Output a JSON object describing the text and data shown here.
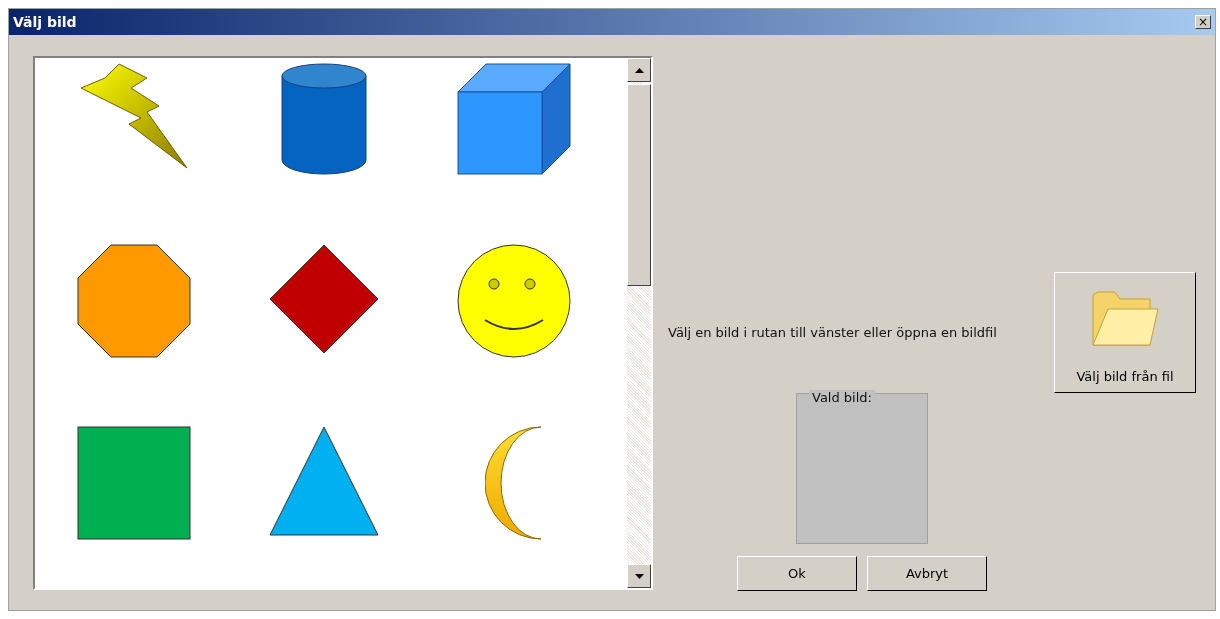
{
  "window": {
    "title": "Välj bild",
    "close_symbol": "×"
  },
  "images": [
    {
      "kind": "lightning"
    },
    {
      "kind": "cylinder"
    },
    {
      "kind": "cube"
    },
    {
      "kind": "octagon"
    },
    {
      "kind": "diamond"
    },
    {
      "kind": "smiley"
    },
    {
      "kind": "square"
    },
    {
      "kind": "triangle"
    },
    {
      "kind": "moon"
    }
  ],
  "instruction": "Välj en bild i rutan till vänster eller öppna en bildfil",
  "open_file_button": "Välj bild från fil",
  "selected_image": {
    "label": "Vald bild:"
  },
  "buttons": [
    "Ok",
    "Avbryt"
  ]
}
